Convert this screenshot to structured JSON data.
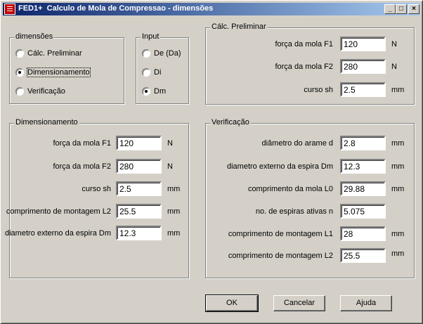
{
  "window": {
    "title": "FED1+  Calculo de Mola de Compressao - dimensões",
    "controls": {
      "minimize": "_",
      "maximize": "□",
      "close": "×"
    }
  },
  "dimensoes": {
    "legend": "dimensões",
    "options": [
      "Cálc. Preliminar",
      "Dimensionamento",
      "Verificação"
    ],
    "selected": "Dimensionamento"
  },
  "input": {
    "legend": "Input",
    "options": [
      "De (Da)",
      "Di",
      "Dm"
    ],
    "selected": "Dm"
  },
  "calc_preliminar": {
    "legend": "Cálc. Preliminar",
    "fields": [
      {
        "label": "força da mola F1",
        "value": "120",
        "unit": "N"
      },
      {
        "label": "força da mola F2",
        "value": "280",
        "unit": "N"
      },
      {
        "label": "curso sh",
        "value": "2.5",
        "unit": "mm"
      }
    ]
  },
  "dimensionamento": {
    "legend": "Dimensionamento",
    "fields": [
      {
        "label": "força da mola F1",
        "value": "120",
        "unit": "N"
      },
      {
        "label": "força da mola F2",
        "value": "280",
        "unit": "N"
      },
      {
        "label": "curso sh",
        "value": "2.5",
        "unit": "mm"
      },
      {
        "label": "comprimento de montagem L2",
        "value": "25.5",
        "unit": "mm"
      },
      {
        "label": "diametro externo da espira Dm",
        "value": "12.3",
        "unit": "mm"
      }
    ]
  },
  "verificacao": {
    "legend": "Verificação",
    "fields": [
      {
        "label": "diâmetro do arame d",
        "value": "2.8",
        "unit": "mm"
      },
      {
        "label": "diametro externo da espira Dm",
        "value": "12.3",
        "unit": "mm"
      },
      {
        "label": "comprimento da mola L0",
        "value": "29.88",
        "unit": "mm"
      },
      {
        "label": "no. de espiras ativas n",
        "value": "5.075",
        "unit": ""
      },
      {
        "label": "comprimento de montagem L1",
        "value": "28",
        "unit": "mm"
      },
      {
        "label": "comprimento de montagem L2",
        "value": "25.5",
        "unit": "mm"
      }
    ]
  },
  "buttons": {
    "ok": "OK",
    "cancel": "Cancelar",
    "help": "Ajuda"
  }
}
